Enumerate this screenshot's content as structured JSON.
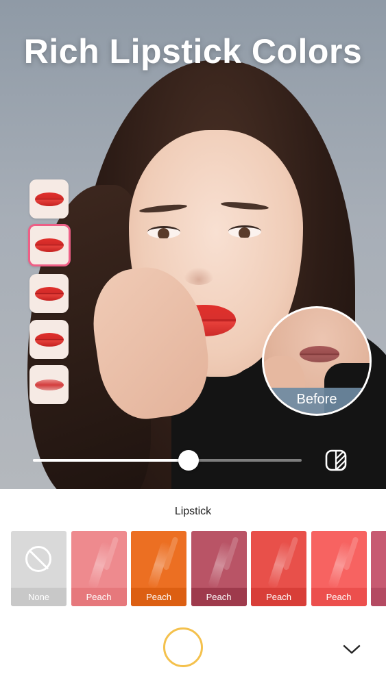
{
  "header": {
    "title": "Rich Lipstick Colors"
  },
  "lip_styles": [
    {
      "name": "lip-style-1",
      "selected": false,
      "finish": "matte"
    },
    {
      "name": "lip-style-2",
      "selected": true,
      "finish": "glossy"
    },
    {
      "name": "lip-style-3",
      "selected": false,
      "finish": "satin"
    },
    {
      "name": "lip-style-4",
      "selected": false,
      "finish": "shimmer"
    },
    {
      "name": "lip-style-5",
      "selected": false,
      "finish": "gradient"
    }
  ],
  "before_preview": {
    "label": "Before"
  },
  "intensity": {
    "value": 0.58
  },
  "panel": {
    "title": "Lipstick"
  },
  "swatches": [
    {
      "label": "None",
      "color": "#d9d9d9",
      "label_bg": "#c8c8c8",
      "none": true
    },
    {
      "label": "Peach",
      "color": "#ee8a8e",
      "label_bg": "#e6787c"
    },
    {
      "label": "Peach",
      "color": "#ec6f22",
      "label_bg": "#dc5f12"
    },
    {
      "label": "Peach",
      "color": "#b95466",
      "label_bg": "#9e3a4c"
    },
    {
      "label": "Peach",
      "color": "#e8504a",
      "label_bg": "#d83e38"
    },
    {
      "label": "Peach",
      "color": "#f76361",
      "label_bg": "#ec4f4d"
    },
    {
      "label": "P",
      "color": "#c75a72",
      "label_bg": "#b44a62"
    }
  ],
  "icons": {
    "compare": "compare-split-icon",
    "none": "no-color-icon",
    "collapse": "chevron-down-icon",
    "shutter": "shutter-button"
  },
  "colors": {
    "accent": "#ee5f86",
    "shutter_ring": "#f4c14d",
    "before_label_bg": "#6e8aa2"
  }
}
